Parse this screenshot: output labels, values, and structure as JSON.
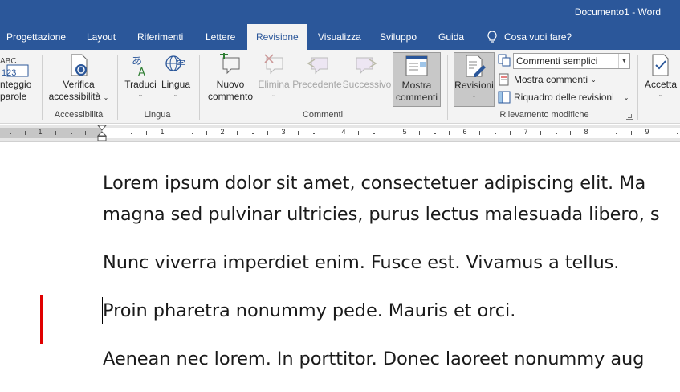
{
  "titlebar": {
    "document": "Documento1",
    "separator": "-",
    "app": "Word"
  },
  "tabs": [
    {
      "label": "Progettazione"
    },
    {
      "label": "Layout"
    },
    {
      "label": "Riferimenti"
    },
    {
      "label": "Lettere"
    },
    {
      "label": "Revisione",
      "active": true
    },
    {
      "label": "Visualizza"
    },
    {
      "label": "Sviluppo"
    },
    {
      "label": "Guida"
    }
  ],
  "tell_me": {
    "label": "Cosa vuoi fare?",
    "icon": "lightbulb-icon"
  },
  "ribbon": {
    "proofing": {
      "label_line1": "nteggio",
      "label_line2": "parole",
      "icon_text_top": "ABC",
      "icon_text_bottom": "123"
    },
    "accessibility": {
      "button_line1": "Verifica",
      "button_line2": "accessibilità",
      "group": "Accessibilità"
    },
    "language": {
      "translate": "Traduci",
      "language": "Lingua",
      "group": "Lingua"
    },
    "comments": {
      "new_line1": "Nuovo",
      "new_line2": "commento",
      "delete": "Elimina",
      "previous": "Precedente",
      "next": "Successivo",
      "show_line1": "Mostra",
      "show_line2": "commenti",
      "group": "Commenti"
    },
    "tracking": {
      "revisions": "Revisioni",
      "markup_select": "Commenti semplici",
      "show_markup": "Mostra commenti",
      "reviewing_pane": "Riquadro delle revisioni",
      "group": "Rilevamento modifiche"
    },
    "changes": {
      "accept": "Accetta"
    }
  },
  "ruler": {
    "numbers": [
      "1",
      "1",
      "2",
      "3",
      "4",
      "5",
      "6",
      "7",
      "8",
      "9"
    ]
  },
  "document": {
    "paragraphs": [
      "Lorem ipsum dolor sit amet, consectetuer adipiscing elit. Ma",
      "magna sed pulvinar ultricies, purus lectus malesuada libero, s",
      "Nunc viverra imperdiet enim. Fusce est. Vivamus a tellus.",
      "Proin pharetra nonummy pede. Mauris et orci.",
      "Aenean nec lorem. In porttitor. Donec laoreet nonummy aug"
    ]
  },
  "colors": {
    "brand": "#2b579a",
    "ribbon_bg": "#f3f3f3",
    "change_bar": "#e00000"
  }
}
